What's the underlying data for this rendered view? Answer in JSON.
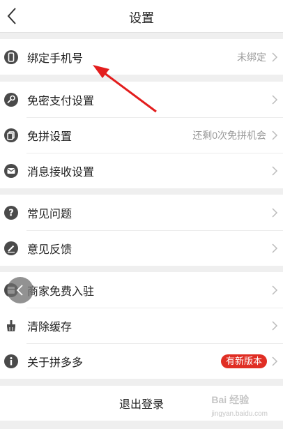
{
  "header": {
    "title": "设置"
  },
  "groups": [
    {
      "items": [
        {
          "label": "绑定手机号",
          "value": "未绑定",
          "icon": "phone-icon"
        }
      ]
    },
    {
      "items": [
        {
          "label": "免密支付设置",
          "value": "",
          "icon": "key-icon"
        },
        {
          "label": "免拼设置",
          "value": "还剩0次免拼机会",
          "icon": "copy-icon"
        },
        {
          "label": "消息接收设置",
          "value": "",
          "icon": "mail-icon"
        }
      ]
    },
    {
      "items": [
        {
          "label": "常见问题",
          "value": "",
          "icon": "question-icon"
        },
        {
          "label": "意见反馈",
          "value": "",
          "icon": "edit-icon"
        }
      ]
    },
    {
      "items": [
        {
          "label": "商家免费入驻",
          "value": "",
          "icon": "store-icon"
        },
        {
          "label": "清除缓存",
          "value": "",
          "icon": "broom-icon"
        },
        {
          "label": "关于拼多多",
          "badge": "有新版本",
          "icon": "info-icon"
        }
      ]
    }
  ],
  "logout": {
    "label": "退出登录"
  },
  "watermark": {
    "brand": "Bai 经验",
    "url": "jingyan.baidu.com"
  },
  "colors": {
    "accent": "#e02e24",
    "icon": "#4a4a4a",
    "arrow": "#e31d1d"
  }
}
